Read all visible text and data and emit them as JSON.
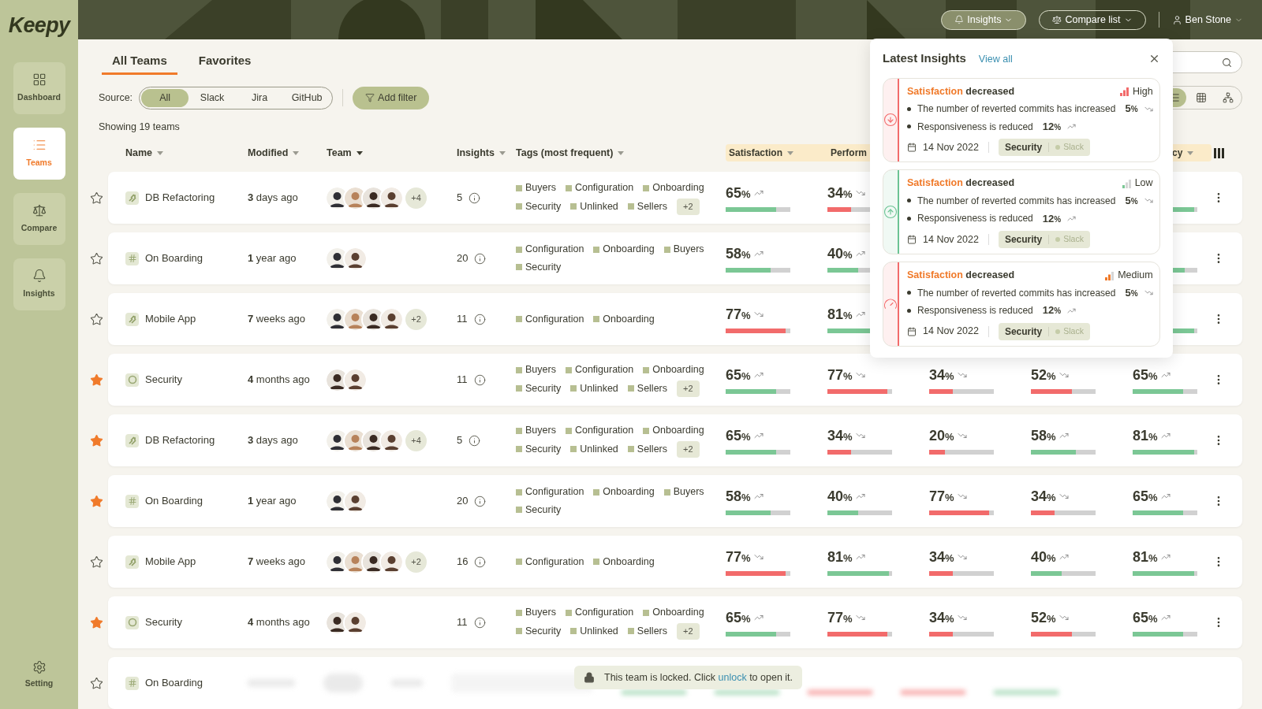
{
  "brand": "Keepy",
  "nav": [
    {
      "label": "Dashboard",
      "kind": "dashboard",
      "selected": false
    },
    {
      "label": "Teams",
      "kind": "teams",
      "selected": true
    },
    {
      "label": "Compare",
      "kind": "compare",
      "selected": false
    },
    {
      "label": "Insights",
      "kind": "insights",
      "selected": false
    }
  ],
  "settings": {
    "label": "Setting"
  },
  "header": {
    "buttons": [
      {
        "label": "Insights",
        "kind": "insights",
        "selected": true
      },
      {
        "label": "Compare list",
        "kind": "compare",
        "selected": false
      }
    ],
    "user": "Ben Stone"
  },
  "tabs": [
    {
      "label": "All Teams",
      "selected": true
    },
    {
      "label": "Favorites",
      "selected": false
    }
  ],
  "source": {
    "label": "Source:",
    "options": [
      {
        "label": "All",
        "selected": true
      },
      {
        "label": "Slack",
        "selected": false
      },
      {
        "label": "Jira",
        "selected": false
      },
      {
        "label": "GitHub",
        "selected": false
      }
    ]
  },
  "add_filter": "Add filter",
  "count": "Showing 19 teams",
  "views": [
    {
      "kind": "list",
      "selected": true
    },
    {
      "kind": "grid",
      "selected": false
    },
    {
      "kind": "tree",
      "selected": false
    }
  ],
  "columns": [
    {
      "label": "Name",
      "sorted": false
    },
    {
      "label": "Modified",
      "sorted": false
    },
    {
      "label": "Team",
      "sorted": true
    },
    {
      "label": "Insights",
      "sorted": false
    },
    {
      "label": "Tags (most frequent)",
      "sorted": false
    }
  ],
  "metric_columns": {
    "column_1": {
      "label": "Satisfaction"
    },
    "column_2": {
      "label": "Perform"
    },
    "column_5": {
      "label": "cy"
    }
  },
  "rows": [
    {
      "favorite": false,
      "kind": "jira",
      "name": "DB Refactoring",
      "modified": "**3** days ago",
      "avatars": [
        {
          "kind": "suit"
        },
        {
          "kind": "beard"
        },
        {
          "kind": "curly"
        },
        {
          "kind": "smile"
        }
      ],
      "more": "+4",
      "insights": "5",
      "tags": [
        "Buyers",
        "Configuration",
        "Onboarding",
        "Security",
        "Unlinked",
        "Sellers"
      ],
      "more_tags": "+2",
      "metrics": {
        "column_1": {
          "value": "65",
          "unit": "%",
          "kind": "up",
          "color": "#7bc795",
          "level": 0.78
        },
        "column_2": {
          "value": "34",
          "unit": "%",
          "kind": "down",
          "color": "#f26b6b",
          "level": 0.36
        },
        "column_5": {
          "color": "#7bc795",
          "level": 0.95
        }
      }
    },
    {
      "favorite": false,
      "kind": "slack",
      "name": "On Boarding",
      "modified": "**1** year ago",
      "avatars": [
        {
          "kind": "suit"
        },
        {
          "kind": "smile"
        }
      ],
      "insights": "20",
      "tags": [
        "Configuration",
        "Onboarding",
        "Buyers",
        "Security"
      ],
      "metrics": {
        "column_1": {
          "value": "58",
          "unit": "%",
          "kind": "up",
          "color": "#7bc795",
          "level": 0.7
        },
        "column_2": {
          "value": "40",
          "unit": "%",
          "kind": "up",
          "color": "#7bc795",
          "level": 0.48
        },
        "column_5": {
          "color": "#7bc795",
          "level": 0.8
        }
      }
    },
    {
      "favorite": false,
      "kind": "jira",
      "name": "Mobile App",
      "modified": "**7** weeks ago",
      "avatars": [
        {
          "kind": "suit"
        },
        {
          "kind": "beard"
        },
        {
          "kind": "curly"
        },
        {
          "kind": "smile"
        }
      ],
      "more": "+2",
      "insights": "11",
      "tags": [
        "Configuration",
        "Onboarding"
      ],
      "metrics": {
        "column_1": {
          "value": "77",
          "unit": "%",
          "kind": "down",
          "color": "#f26b6b",
          "level": 0.93
        },
        "column_2": {
          "value": "81",
          "unit": "%",
          "kind": "up",
          "color": "#7bc795",
          "level": 0.95
        },
        "column_5": {
          "color": "#7bc795",
          "level": 0.95
        }
      }
    },
    {
      "favorite": true,
      "kind": "github",
      "name": "Security",
      "modified": "**4** months ago",
      "avatars": [
        {
          "kind": "curly"
        },
        {
          "kind": "smile"
        }
      ],
      "insights": "11",
      "tags": [
        "Buyers",
        "Configuration",
        "Onboarding",
        "Security",
        "Unlinked",
        "Sellers"
      ],
      "more_tags": "+2",
      "metrics": {
        "column_1": {
          "value": "65",
          "unit": "%",
          "kind": "up",
          "color": "#7bc795",
          "level": 0.78
        },
        "column_2": {
          "value": "77",
          "unit": "%",
          "kind": "down",
          "color": "#f26b6b",
          "level": 0.93
        },
        "column_3": {
          "value": "34",
          "unit": "%",
          "kind": "down",
          "color": "#f26b6b",
          "level": 0.36
        },
        "column_4": {
          "value": "52",
          "unit": "%",
          "kind": "down",
          "color": "#f26b6b",
          "level": 0.63
        },
        "column_5": {
          "value": "65",
          "unit": "%",
          "kind": "up",
          "color": "#7bc795",
          "level": 0.78
        }
      }
    },
    {
      "favorite": true,
      "kind": "jira",
      "name": "DB Refactoring",
      "modified": "**3** days ago",
      "avatars": [
        {
          "kind": "suit"
        },
        {
          "kind": "beard"
        },
        {
          "kind": "curly"
        },
        {
          "kind": "smile"
        }
      ],
      "more": "+4",
      "insights": "5",
      "tags": [
        "Buyers",
        "Configuration",
        "Onboarding",
        "Security",
        "Unlinked",
        "Sellers"
      ],
      "more_tags": "+2",
      "metrics": {
        "column_1": {
          "value": "65",
          "unit": "%",
          "kind": "up",
          "color": "#7bc795",
          "level": 0.78
        },
        "column_2": {
          "value": "34",
          "unit": "%",
          "kind": "down",
          "color": "#f26b6b",
          "level": 0.36
        },
        "column_3": {
          "value": "20",
          "unit": "%",
          "kind": "down",
          "color": "#f26b6b",
          "level": 0.24
        },
        "column_4": {
          "value": "58",
          "unit": "%",
          "kind": "up",
          "color": "#7bc795",
          "level": 0.7
        },
        "column_5": {
          "value": "81",
          "unit": "%",
          "kind": "up",
          "color": "#7bc795",
          "level": 0.95
        }
      }
    },
    {
      "favorite": true,
      "kind": "slack",
      "name": "On Boarding",
      "modified": "**1** year ago",
      "avatars": [
        {
          "kind": "suit"
        },
        {
          "kind": "smile"
        }
      ],
      "insights": "20",
      "tags": [
        "Configuration",
        "Onboarding",
        "Buyers",
        "Security"
      ],
      "metrics": {
        "column_1": {
          "value": "58",
          "unit": "%",
          "kind": "up",
          "color": "#7bc795",
          "level": 0.7
        },
        "column_2": {
          "value": "40",
          "unit": "%",
          "kind": "up",
          "color": "#7bc795",
          "level": 0.48
        },
        "column_3": {
          "value": "77",
          "unit": "%",
          "kind": "down",
          "color": "#f26b6b",
          "level": 0.93
        },
        "column_4": {
          "value": "34",
          "unit": "%",
          "kind": "down",
          "color": "#f26b6b",
          "level": 0.36
        },
        "column_5": {
          "value": "65",
          "unit": "%",
          "kind": "up",
          "color": "#7bc795",
          "level": 0.78
        }
      }
    },
    {
      "favorite": false,
      "kind": "jira",
      "name": "Mobile App",
      "modified": "**7** weeks ago",
      "avatars": [
        {
          "kind": "suit"
        },
        {
          "kind": "beard"
        },
        {
          "kind": "curly"
        },
        {
          "kind": "smile"
        }
      ],
      "more": "+2",
      "insights": "16",
      "tags": [
        "Configuration",
        "Onboarding"
      ],
      "metrics": {
        "column_1": {
          "value": "77",
          "unit": "%",
          "kind": "down",
          "color": "#f26b6b",
          "level": 0.93
        },
        "column_2": {
          "value": "81",
          "unit": "%",
          "kind": "up",
          "color": "#7bc795",
          "level": 0.95
        },
        "column_3": {
          "value": "34",
          "unit": "%",
          "kind": "down",
          "color": "#f26b6b",
          "level": 0.36
        },
        "column_4": {
          "value": "40",
          "unit": "%",
          "kind": "up",
          "color": "#7bc795",
          "level": 0.48
        },
        "column_5": {
          "value": "81",
          "unit": "%",
          "kind": "up",
          "color": "#7bc795",
          "level": 0.95
        }
      }
    },
    {
      "favorite": true,
      "kind": "github",
      "name": "Security",
      "modified": "**4** months ago",
      "avatars": [
        {
          "kind": "curly"
        },
        {
          "kind": "smile"
        }
      ],
      "insights": "11",
      "tags": [
        "Buyers",
        "Configuration",
        "Onboarding",
        "Security",
        "Unlinked",
        "Sellers"
      ],
      "more_tags": "+2",
      "metrics": {
        "column_1": {
          "value": "65",
          "unit": "%",
          "kind": "up",
          "color": "#7bc795",
          "level": 0.78
        },
        "column_2": {
          "value": "77",
          "unit": "%",
          "kind": "down",
          "color": "#f26b6b",
          "level": 0.93
        },
        "column_3": {
          "value": "34",
          "unit": "%",
          "kind": "down",
          "color": "#f26b6b",
          "level": 0.36
        },
        "column_4": {
          "value": "52",
          "unit": "%",
          "kind": "down",
          "color": "#f26b6b",
          "level": 0.63
        },
        "column_5": {
          "value": "65",
          "unit": "%",
          "kind": "up",
          "color": "#7bc795",
          "level": 0.78
        }
      }
    },
    {
      "favorite": false,
      "kind": "slack",
      "name": "On Boarding",
      "locked": true
    }
  ],
  "locked_notice": {
    "before": "This team is locked. Click",
    "link": "unlock",
    "after": "to open it."
  },
  "insights_panel": {
    "title": "Latest Insights",
    "link": "View all",
    "cards": [
      {
        "kind": "down",
        "color": "#f26b6b",
        "metric": "Satisfaction",
        "change": "decreased",
        "severity": {
          "kind": "high",
          "label": "High"
        },
        "lines": [
          {
            "text": "The number of reverted commits has increased",
            "value": "5",
            "unit": "%",
            "kind": "down"
          },
          {
            "text": "Responsiveness is reduced",
            "value": "12",
            "unit": "%",
            "kind": "up"
          }
        ],
        "date": "14 Nov 2022",
        "tag": "Security",
        "source": "Slack"
      },
      {
        "kind": "up",
        "color": "#6cc394",
        "metric": "Satisfaction",
        "change": "decreased",
        "severity": {
          "kind": "low",
          "label": "Low"
        },
        "lines": [
          {
            "text": "The number of reverted commits has increased",
            "value": "5",
            "unit": "%",
            "kind": "down"
          },
          {
            "text": "Responsiveness is reduced",
            "value": "12",
            "unit": "%",
            "kind": "up"
          }
        ],
        "date": "14 Nov 2022",
        "tag": "Security",
        "source": "Slack"
      },
      {
        "kind": "gauge",
        "color": "#f26b6b",
        "metric": "Satisfaction",
        "change": "decreased",
        "severity": {
          "kind": "medium",
          "label": "Medium"
        },
        "lines": [
          {
            "text": "The number of reverted commits has increased",
            "value": "5",
            "unit": "%",
            "kind": "down"
          },
          {
            "text": "Responsiveness is reduced",
            "value": "12",
            "unit": "%",
            "kind": "up"
          }
        ],
        "date": "14 Nov 2022",
        "tag": "Security",
        "source": "Slack"
      }
    ]
  }
}
